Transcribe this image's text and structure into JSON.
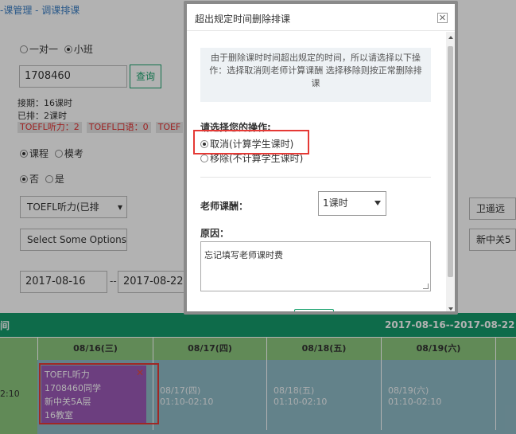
{
  "breadcrumb": "-课管理 - 调课排课",
  "class_type": {
    "options": [
      "一对一",
      "小班"
    ],
    "selected": "小班"
  },
  "search": {
    "value": "1708460",
    "button": "查询"
  },
  "info": {
    "period": "接期：16课时",
    "scheduled": "已排：2课时",
    "tags": [
      "TOEFL听力：2",
      "TOEFL口语：0",
      "TOEF"
    ]
  },
  "mode": {
    "options": [
      "课程",
      "模考"
    ],
    "selected": "课程"
  },
  "yesno": {
    "options": [
      "否",
      "是"
    ],
    "selected": "否"
  },
  "course_select": "TOEFL听力(已排",
  "multi_select": "Select Some Options",
  "teacher_btn": "卫遥远",
  "campus_btn": "新中关5",
  "date_from": "2017-08-16",
  "date_dash": "--",
  "date_to": "2017-08-22",
  "table": {
    "corner": "间",
    "range": "2017-08-16--2017-08-22",
    "days": [
      "08/16(三)",
      "08/17(四)",
      "08/18(五)",
      "08/19(六)"
    ],
    "time": "2:10",
    "cells": [
      {
        "date": "08/17(四)",
        "time": "01:10-02:10"
      },
      {
        "date": "08/18(五)",
        "time": "01:10-02:10"
      },
      {
        "date": "08/19(六)",
        "time": "01:10-02:10"
      }
    ],
    "card": [
      "TOEFL听力",
      "1708460同学",
      "新中关5A层",
      "16教室"
    ],
    "card_close": "✕"
  },
  "modal": {
    "title": "超出规定时间删除排课",
    "close": "✕",
    "notice": "由于删除课时时间超出规定的时间，所以请选择以下操作：选择取消则老师计算课酬 选择移除则按正常删除排课",
    "choose_label": "请选择您的操作:",
    "options": [
      "取消(计算学生课时)",
      "移除(不计算学生课时)"
    ],
    "selected": "取消(计算学生课时)",
    "fee_label": "老师课酬：",
    "fee_value": "1课时",
    "reason_label": "原因：",
    "reason_value": "忘记填写老师课时费"
  },
  "colors": {
    "accent": "#1aa26e",
    "header": "#159a6a",
    "subheader": "#8cc67d",
    "cell": "#8fbac6",
    "card": "#9b59b6",
    "highlight": "#e53935"
  }
}
